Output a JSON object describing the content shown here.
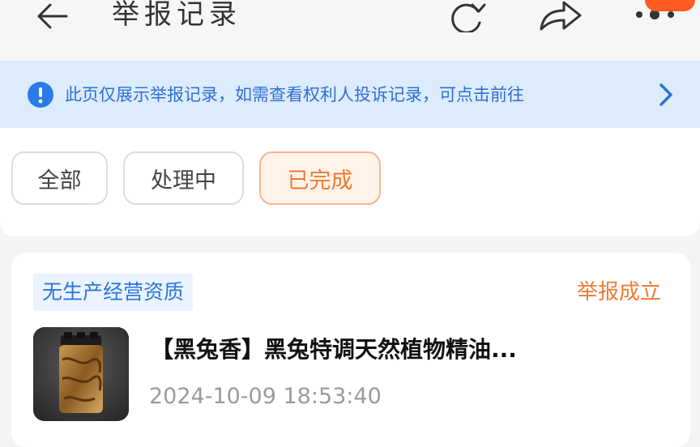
{
  "header": {
    "title": "举报记录",
    "icons": [
      "back-arrow-icon",
      "refresh-icon",
      "share-icon",
      "more-icon"
    ],
    "badge_color": "#ff5a1f"
  },
  "notice": {
    "text": "此页仅展示举报记录，如需查看权利人投诉记录，可点击前往",
    "accent": "#2f6fd4"
  },
  "filters": [
    {
      "label": "全部",
      "active": false
    },
    {
      "label": "处理中",
      "active": false
    },
    {
      "label": "已完成",
      "active": true
    }
  ],
  "record": {
    "tag": "无生产经营资质",
    "status": "举报成立",
    "title": "【黑兔香】黑兔特调天然植物精油...",
    "time": "2024-10-09 18:53:40",
    "status_color": "#ef7b35"
  }
}
